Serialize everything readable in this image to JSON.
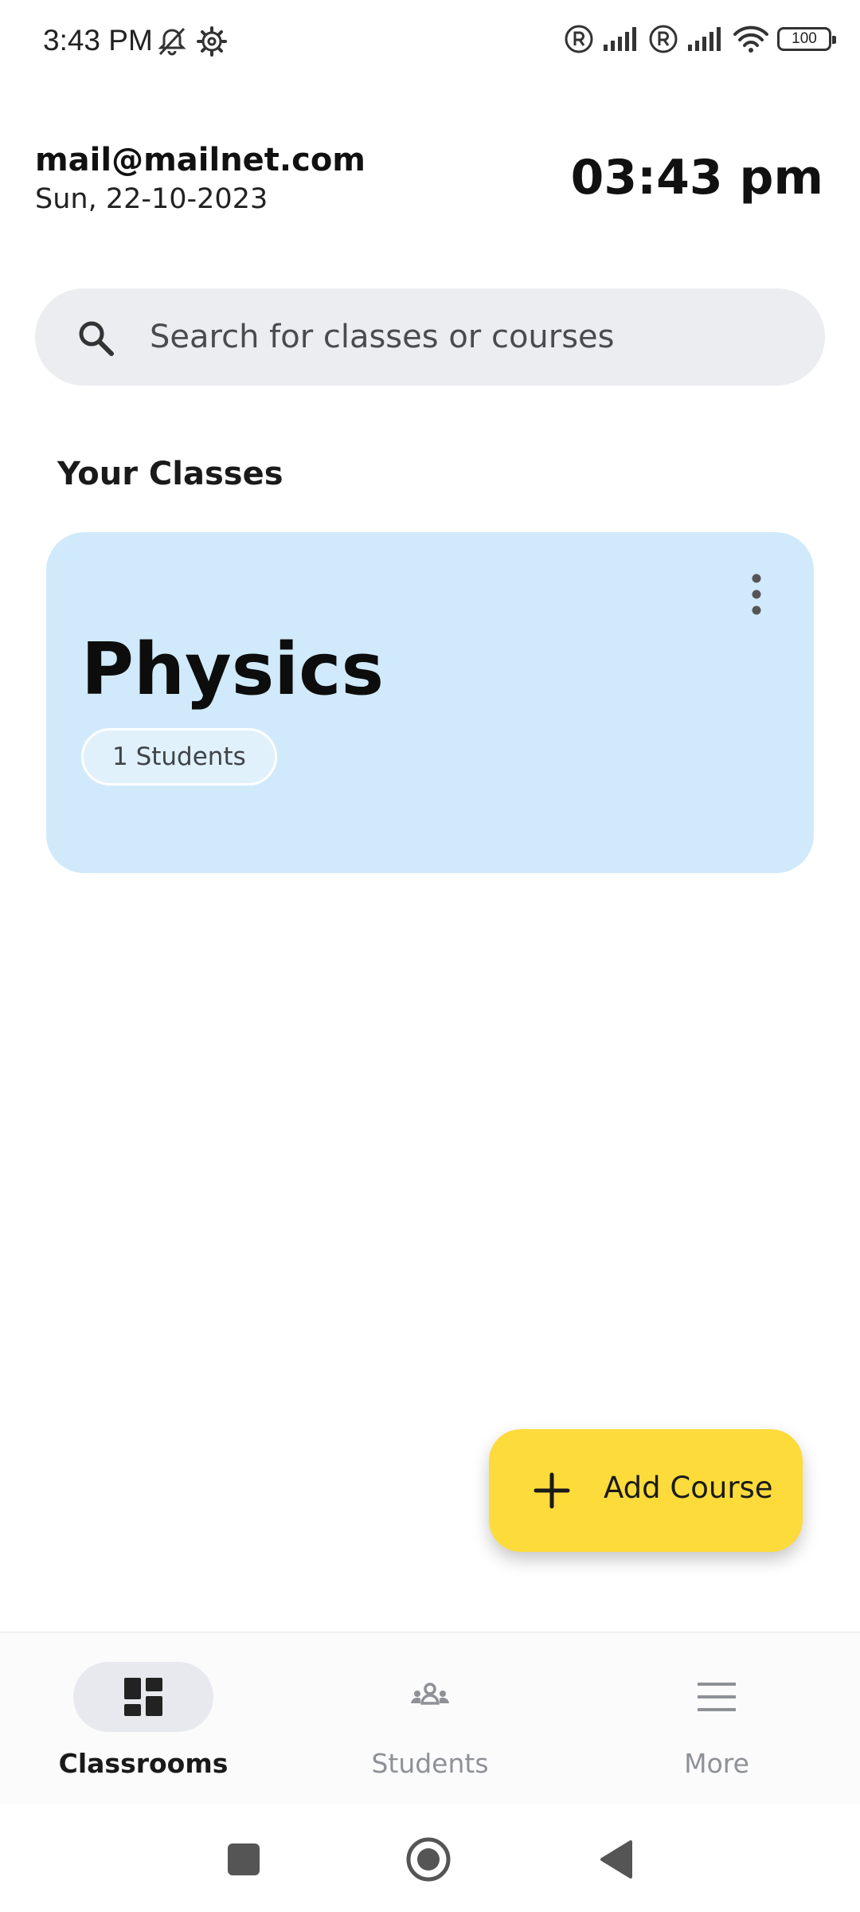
{
  "status_bar": {
    "time": "3:43 PM",
    "left_icons": [
      "bell-off-icon",
      "settings-icon"
    ],
    "right_icons": [
      "registered-icon",
      "signal-icon",
      "registered-icon",
      "signal-icon",
      "wifi-icon"
    ],
    "battery_level": "100"
  },
  "header": {
    "email": "mail@mailnet.com",
    "date": "Sun, 22-10-2023",
    "clock": "03:43 pm"
  },
  "search": {
    "placeholder": "Search for classes or courses",
    "value": ""
  },
  "classes_section": {
    "title": "Your Classes",
    "cards": [
      {
        "name": "Physics",
        "students_badge": "1 Students",
        "color": "#d0eafb"
      }
    ]
  },
  "fab": {
    "label": "Add Course",
    "color": "#fddb3a"
  },
  "bottom_nav": {
    "items": [
      {
        "label": "Classrooms",
        "icon": "dashboard-icon",
        "active": true
      },
      {
        "label": "Students",
        "icon": "people-icon",
        "active": false
      },
      {
        "label": "More",
        "icon": "menu-icon",
        "active": false
      }
    ]
  },
  "system_nav": {
    "buttons": [
      "recents-square-icon",
      "home-circle-icon",
      "back-triangle-icon"
    ]
  }
}
